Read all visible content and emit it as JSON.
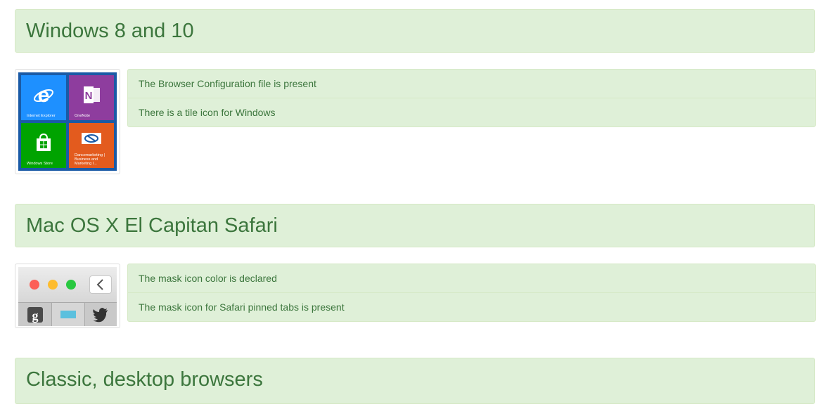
{
  "sections": [
    {
      "title": "Windows 8 and 10",
      "items": [
        "The Browser Configuration file is present",
        "There is a tile icon for Windows"
      ],
      "tiles": [
        {
          "caption": "Internet Explorer",
          "icon": "internet-explorer-icon",
          "color": "#1e90ff"
        },
        {
          "caption": "OneNote",
          "icon": "onenote-icon",
          "color": "#8e3d9e"
        },
        {
          "caption": "Windows Store",
          "icon": "windows-store-icon",
          "color": "#00a300"
        },
        {
          "caption": "Dancemarketing | Business and Marketing I...",
          "icon": "site-tile-icon",
          "color": "#e35b1e"
        }
      ]
    },
    {
      "title": "Mac OS X El Capitan Safari",
      "items": [
        "The mask icon color is declared",
        "The mask icon for Safari pinned tabs is present"
      ]
    },
    {
      "title": "Classic, desktop browsers"
    }
  ],
  "colors": {
    "panel_bg": "#dff0d8",
    "panel_border": "#d6e9c6",
    "text": "#3c763d"
  }
}
